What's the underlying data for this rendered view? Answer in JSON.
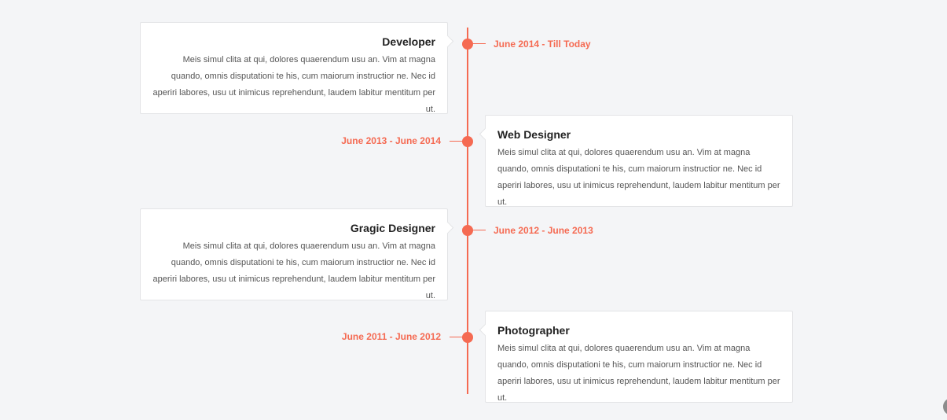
{
  "timeline": {
    "accent_color": "#f56a52",
    "items": [
      {
        "title": "Developer",
        "date": "June 2014 - Till Today",
        "side": "left",
        "text": "Meis simul clita at qui, dolores quaerendum usu an. Vim at magna quando, omnis disputationi te his, cum maiorum instructior ne. Nec id aperiri labores, usu ut inimicus reprehendunt, laudem labitur mentitum per ut."
      },
      {
        "title": "Web Designer",
        "date": "June 2013 - June 2014",
        "side": "right",
        "text": "Meis simul clita at qui, dolores quaerendum usu an. Vim at magna quando, omnis disputationi te his, cum maiorum instructior ne. Nec id aperiri labores, usu ut inimicus reprehendunt, laudem labitur mentitum per ut."
      },
      {
        "title": "Gragic Designer",
        "date": "June 2012 - June 2013",
        "side": "left",
        "text": "Meis simul clita at qui, dolores quaerendum usu an. Vim at magna quando, omnis disputationi te his, cum maiorum instructior ne. Nec id aperiri labores, usu ut inimicus reprehendunt, laudem labitur mentitum per ut."
      },
      {
        "title": "Photographer",
        "date": "June 2011 - June 2012",
        "side": "right",
        "text": "Meis simul clita at qui, dolores quaerendum usu an. Vim at magna quando, omnis disputationi te his, cum maiorum instructior ne. Nec id aperiri labores, usu ut inimicus reprehendunt, laudem labitur mentitum per ut."
      }
    ]
  },
  "scroll_button": {
    "icon": "scroll-to-top-icon"
  }
}
